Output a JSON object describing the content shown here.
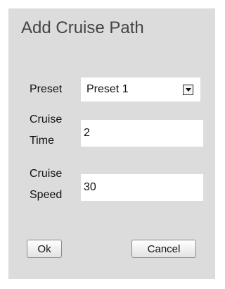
{
  "dialog": {
    "title": "Add Cruise Path",
    "preset": {
      "label": "Preset",
      "value": "Preset 1",
      "arrow_icon": "dropdown-arrow-icon"
    },
    "cruise_time": {
      "label_line1": "Cruise",
      "label_line2": "Time",
      "value": "2"
    },
    "cruise_speed": {
      "label_line1": "Cruise",
      "label_line2": "Speed",
      "value": "30"
    },
    "buttons": {
      "ok": "Ok",
      "cancel": "Cancel"
    }
  }
}
